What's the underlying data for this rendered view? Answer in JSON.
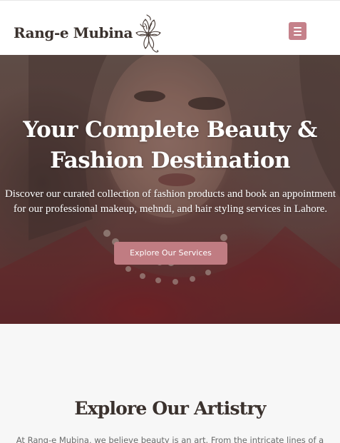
{
  "header": {
    "brand_name": "Rang-e Mubina",
    "logo_icon": "henna-flower-icon",
    "menu_icon": "hamburger-menu-icon",
    "menu_color": "#c5818a"
  },
  "hero": {
    "title": "Your Complete Beauty & Fashion Destination",
    "subtitle": "Discover our curated collection of fashion products and book an appointment for our professional makeup, mehndi, and hair styling services in Lahore.",
    "cta_label": "Explore Our Services",
    "cta_color": "#c07c82"
  },
  "artistry": {
    "title": "Explore Our Artistry",
    "intro": "At Rang-e Mubina, we believe beauty is an art. From the intricate lines of a"
  }
}
